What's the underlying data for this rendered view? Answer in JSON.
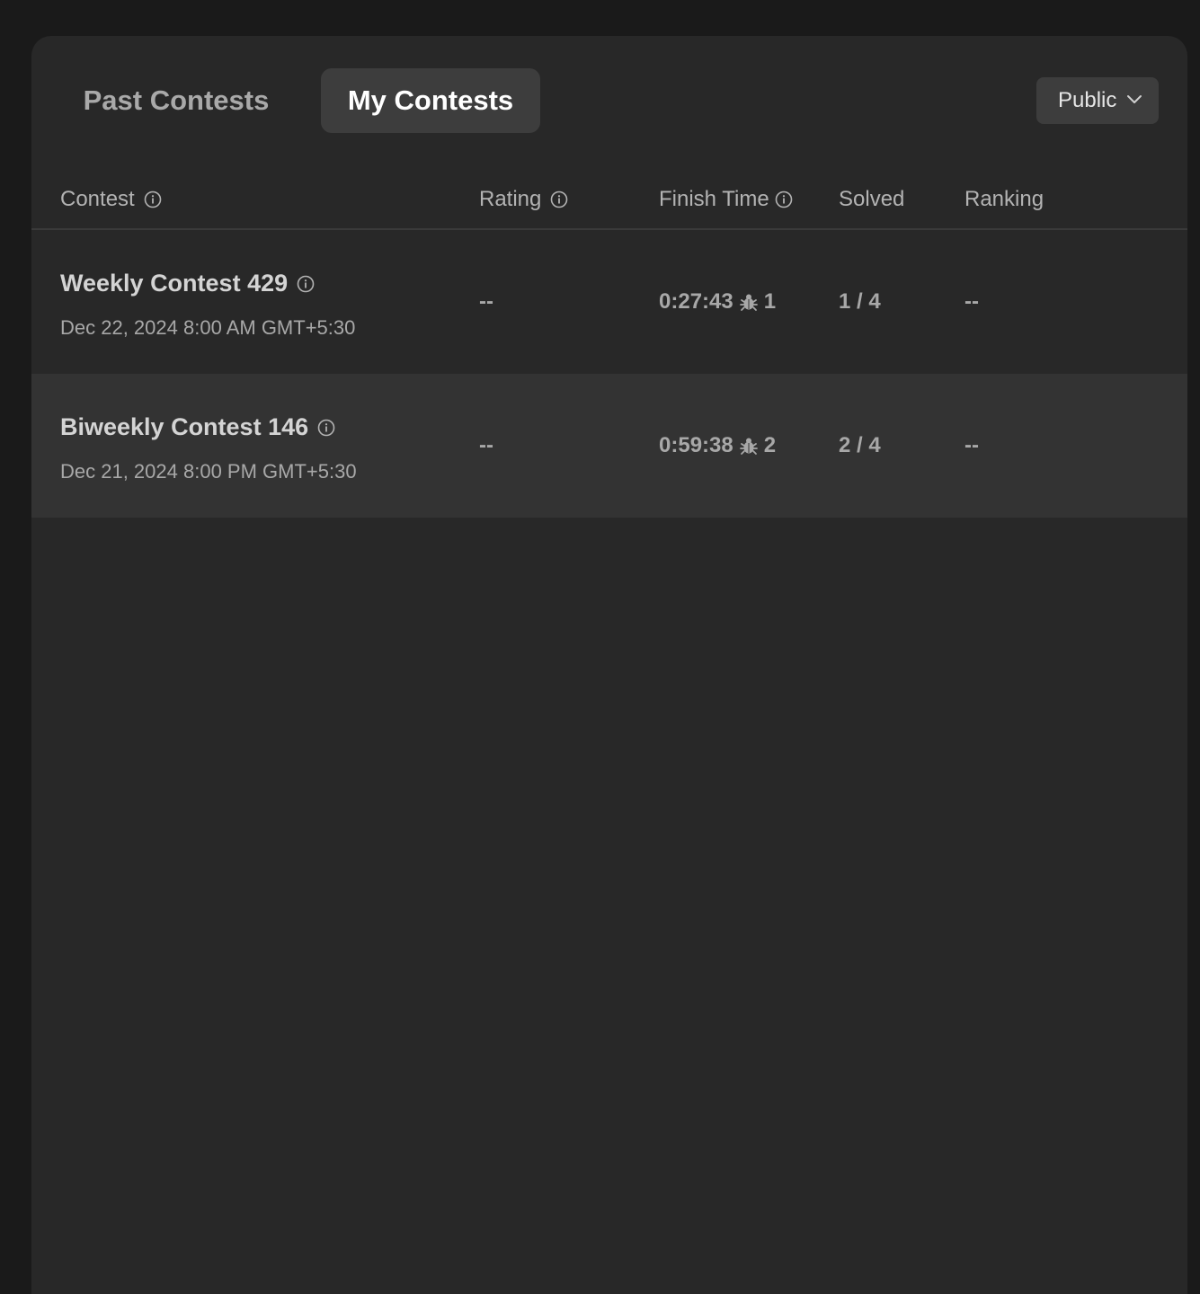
{
  "tabs": {
    "past": "Past Contests",
    "mine": "My Contests"
  },
  "visibility": {
    "selected": "Public"
  },
  "table": {
    "headers": {
      "contest": "Contest",
      "rating": "Rating",
      "finish_time": "Finish Time",
      "solved": "Solved",
      "ranking": "Ranking"
    },
    "rows": [
      {
        "name": "Weekly Contest 429",
        "date": "Dec 22, 2024 8:00 AM GMT+5:30",
        "rating": "--",
        "finish_time": "0:27:43",
        "bugs": "1",
        "solved": "1 / 4",
        "ranking": "--"
      },
      {
        "name": "Biweekly Contest 146",
        "date": "Dec 21, 2024 8:00 PM GMT+5:30",
        "rating": "--",
        "finish_time": "0:59:38",
        "bugs": "2",
        "solved": "2 / 4",
        "ranking": "--"
      }
    ]
  },
  "colors": {
    "page_bg": "#1a1a1a",
    "panel_bg": "#282828",
    "active_tab_bg": "#3d3d3d",
    "highlight_row_bg": "#333333"
  }
}
